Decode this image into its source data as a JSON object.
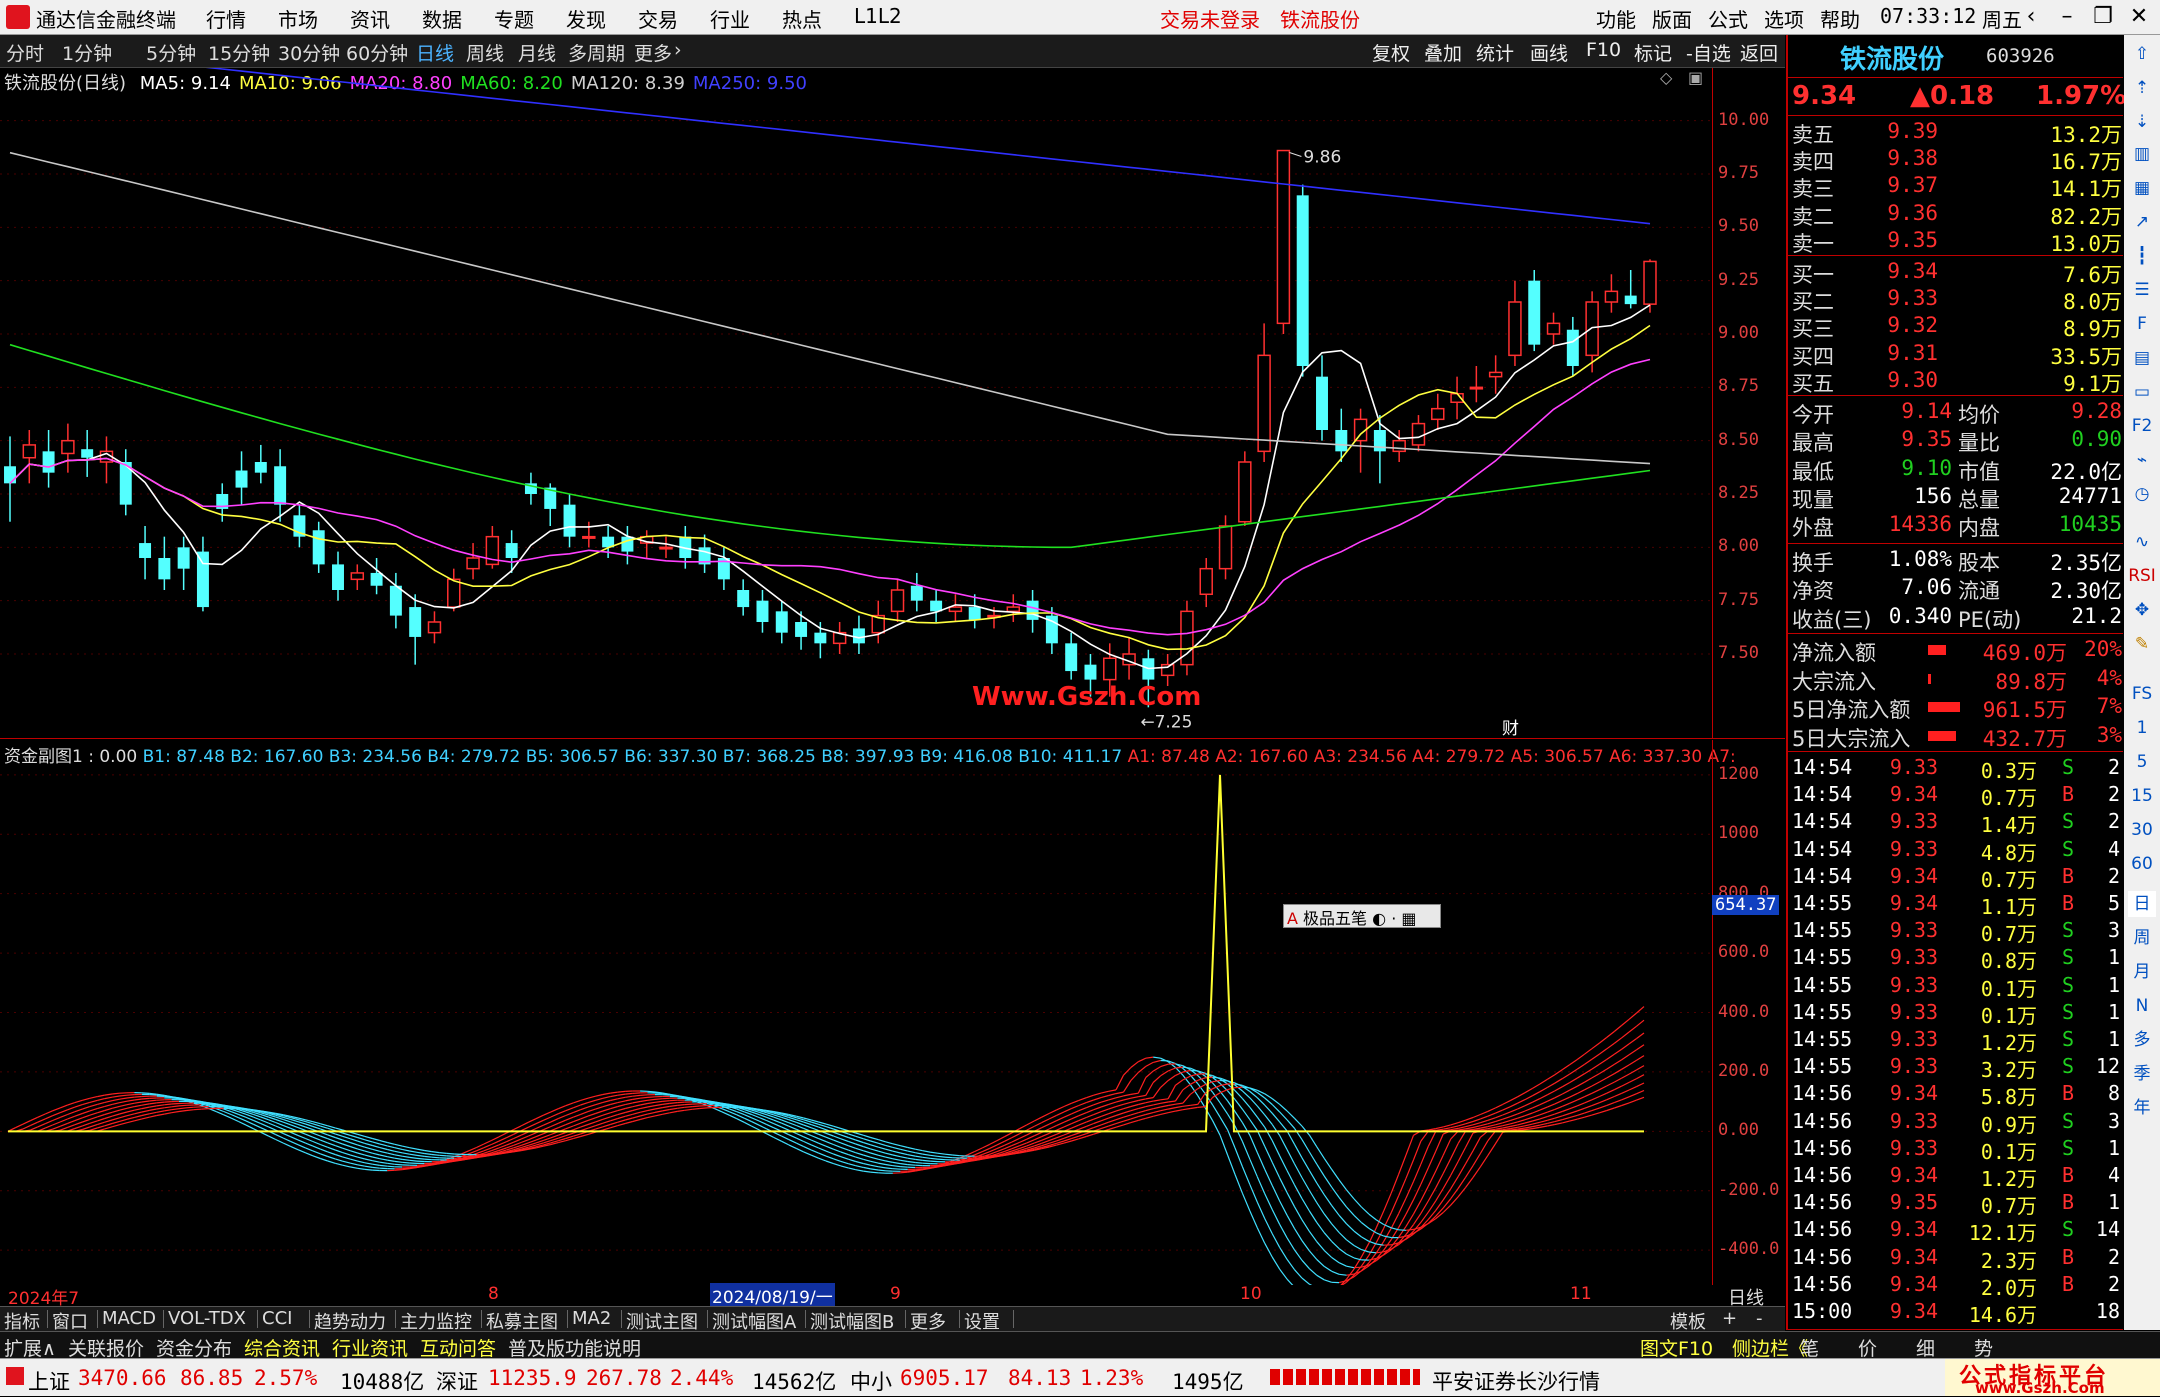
{
  "menubar": {
    "app_title": "通达信金融终端",
    "menus": [
      "行情",
      "市场",
      "资讯",
      "数据",
      "专题",
      "发现",
      "交易",
      "行业",
      "热点",
      "L1L2"
    ],
    "trade_status": "交易未登录",
    "stock_link": "铁流股份",
    "right_menus": [
      "功能",
      "版面",
      "公式",
      "选项",
      "帮助"
    ],
    "clock": "07:33:12",
    "weekday": "周五"
  },
  "periodbar": {
    "periods": [
      "分时",
      "1分钟",
      "5分钟",
      "15分钟",
      "30分钟",
      "60分钟",
      "日线",
      "周线",
      "月线",
      "多周期",
      "更多"
    ],
    "active": "日线",
    "tools": [
      "复权",
      "叠加",
      "统计",
      "画线",
      "F10",
      "标记",
      "-自选",
      "返回"
    ]
  },
  "mainchart": {
    "title": "铁流股份(日线)",
    "ma": [
      {
        "label": "MA5: 9.14",
        "color": "#ffffff"
      },
      {
        "label": "MA10: 9.06",
        "color": "#ffff40"
      },
      {
        "label": "MA20: 8.80",
        "color": "#ff40ff"
      },
      {
        "label": "MA60: 8.20",
        "color": "#20e020"
      },
      {
        "label": "MA120: 8.39",
        "color": "#d0d0d0"
      },
      {
        "label": "MA250: 9.50",
        "color": "#4040ff"
      }
    ],
    "yticks": [
      "10.00",
      "9.75",
      "9.50",
      "9.25",
      "9.00",
      "8.75",
      "8.50",
      "8.25",
      "8.00",
      "7.75",
      "7.50"
    ],
    "high_label": "9.86",
    "low_label": "7.25",
    "watermark": "Www.Gszh.Com",
    "marker": "财"
  },
  "subchart": {
    "title": "资金副图1 : 0.00",
    "b_values": "B1: 87.48  B2: 167.60  B3: 234.56  B4: 279.72  B5: 306.57  B6: 337.30  B7: 368.25  B8: 397.93  B9: 416.08  B10: 411.17",
    "a_values": "A1: 87.48  A2: 167.60  A3: 234.56  A4: 279.72  A5: 306.57  A6: 337.30  A7:",
    "yticks": [
      "1200",
      "1000",
      "800.0",
      "600.0",
      "400.0",
      "200.0",
      "0.00",
      "-200.0",
      "-400.0"
    ],
    "current_value": "654.37",
    "popup_label": "极品五笔",
    "x_labels": [
      "2024年7",
      "8",
      "2024/08/19/一",
      "9",
      "10",
      "11"
    ],
    "period_label": "日线"
  },
  "quote": {
    "name": "铁流股份",
    "code": "603926",
    "price": "9.34",
    "change": "▲0.18",
    "pct": "1.97%",
    "asks": [
      {
        "label": "卖五",
        "price": "9.39",
        "vol": "13.2万"
      },
      {
        "label": "卖四",
        "price": "9.38",
        "vol": "16.7万"
      },
      {
        "label": "卖三",
        "price": "9.37",
        "vol": "14.1万"
      },
      {
        "label": "卖二",
        "price": "9.36",
        "vol": "82.2万"
      },
      {
        "label": "卖一",
        "price": "9.35",
        "vol": "13.0万"
      }
    ],
    "bids": [
      {
        "label": "买一",
        "price": "9.34",
        "vol": "7.6万"
      },
      {
        "label": "买二",
        "price": "9.33",
        "vol": "8.0万"
      },
      {
        "label": "买三",
        "price": "9.32",
        "vol": "8.9万"
      },
      {
        "label": "买四",
        "price": "9.31",
        "vol": "33.5万"
      },
      {
        "label": "买五",
        "price": "9.30",
        "vol": "9.1万"
      }
    ],
    "stats": [
      {
        "l1": "今开",
        "v1": "9.14",
        "c1": "red",
        "l2": "均价",
        "v2": "9.28",
        "c2": "red"
      },
      {
        "l1": "最高",
        "v1": "9.35",
        "c1": "red",
        "l2": "量比",
        "v2": "0.90",
        "c2": "grn"
      },
      {
        "l1": "最低",
        "v1": "9.10",
        "c1": "grn",
        "l2": "市值",
        "v2": "22.0亿",
        "c2": "wht"
      },
      {
        "l1": "现量",
        "v1": "156",
        "c1": "wht",
        "l2": "总量",
        "v2": "24771",
        "c2": "wht"
      },
      {
        "l1": "外盘",
        "v1": "14336",
        "c1": "red",
        "l2": "内盘",
        "v2": "10435",
        "c2": "grn"
      }
    ],
    "fund": [
      {
        "l1": "换手",
        "v1": "1.08%",
        "l2": "股本",
        "v2": "2.35亿"
      },
      {
        "l1": "净资",
        "v1": "7.06",
        "l2": "流通",
        "v2": "2.30亿"
      },
      {
        "l1": "收益(三)",
        "v1": "0.340",
        "l2": "PE(动)",
        "v2": "21.2"
      }
    ],
    "flows": [
      {
        "label": "净流入额",
        "value": "469.0万",
        "pct": "20%",
        "bar": 18
      },
      {
        "label": "大宗流入",
        "value": "89.8万",
        "pct": "4%",
        "bar": 3
      },
      {
        "label": "5日净流入额",
        "value": "961.5万",
        "pct": "7%",
        "bar": 32
      },
      {
        "label": "5日大宗流入",
        "value": "432.7万",
        "pct": "3%",
        "bar": 28
      }
    ],
    "ticks": [
      {
        "t": "14:54",
        "p": "9.33",
        "v": "0.3万",
        "d": "S",
        "n": "2"
      },
      {
        "t": "14:54",
        "p": "9.34",
        "v": "0.7万",
        "d": "B",
        "n": "2"
      },
      {
        "t": "14:54",
        "p": "9.33",
        "v": "1.4万",
        "d": "S",
        "n": "2"
      },
      {
        "t": "14:54",
        "p": "9.33",
        "v": "4.8万",
        "d": "S",
        "n": "4"
      },
      {
        "t": "14:54",
        "p": "9.34",
        "v": "0.7万",
        "d": "B",
        "n": "2"
      },
      {
        "t": "14:55",
        "p": "9.34",
        "v": "1.1万",
        "d": "B",
        "n": "5"
      },
      {
        "t": "14:55",
        "p": "9.33",
        "v": "0.7万",
        "d": "S",
        "n": "3"
      },
      {
        "t": "14:55",
        "p": "9.33",
        "v": "0.8万",
        "d": "S",
        "n": "1"
      },
      {
        "t": "14:55",
        "p": "9.33",
        "v": "0.1万",
        "d": "S",
        "n": "1"
      },
      {
        "t": "14:55",
        "p": "9.33",
        "v": "0.1万",
        "d": "S",
        "n": "1"
      },
      {
        "t": "14:55",
        "p": "9.33",
        "v": "1.2万",
        "d": "S",
        "n": "1"
      },
      {
        "t": "14:55",
        "p": "9.33",
        "v": "3.2万",
        "d": "S",
        "n": "12"
      },
      {
        "t": "14:56",
        "p": "9.34",
        "v": "5.8万",
        "d": "B",
        "n": "8"
      },
      {
        "t": "14:56",
        "p": "9.33",
        "v": "0.9万",
        "d": "S",
        "n": "3"
      },
      {
        "t": "14:56",
        "p": "9.33",
        "v": "0.1万",
        "d": "S",
        "n": "1"
      },
      {
        "t": "14:56",
        "p": "9.34",
        "v": "1.2万",
        "d": "B",
        "n": "4"
      },
      {
        "t": "14:56",
        "p": "9.35",
        "v": "0.7万",
        "d": "B",
        "n": "1"
      },
      {
        "t": "14:56",
        "p": "9.34",
        "v": "12.1万",
        "d": "S",
        "n": "14"
      },
      {
        "t": "14:56",
        "p": "9.34",
        "v": "2.3万",
        "d": "B",
        "n": "2"
      },
      {
        "t": "14:56",
        "p": "9.34",
        "v": "2.0万",
        "d": "B",
        "n": "2"
      },
      {
        "t": "15:00",
        "p": "9.34",
        "v": "14.6万",
        "d": "",
        "n": "18"
      }
    ],
    "bottom_tabs": [
      "笔",
      "价",
      "细",
      "势"
    ]
  },
  "tabs1": [
    "指标",
    "窗口",
    "MACD",
    "VOL-TDX",
    "CCI",
    "趋势动力",
    "主力监控",
    "私募主图",
    "MA2",
    "测试主图",
    "测试幅图A",
    "测试幅图B",
    "更多",
    "设置"
  ],
  "tabs1_right": [
    "模板",
    "+",
    "-"
  ],
  "tabs2": [
    {
      "label": "扩展∧",
      "color": "#ddd"
    },
    {
      "label": "关联报价",
      "color": "#ddd"
    },
    {
      "label": "资金分布",
      "color": "#ddd"
    },
    {
      "label": "综合资讯",
      "color": "#ffff40"
    },
    {
      "label": "行业资讯",
      "color": "#ffff40"
    },
    {
      "label": "互动问答",
      "color": "#ffff40"
    },
    {
      "label": "普及版功能说明",
      "color": "#ddd"
    }
  ],
  "tabs2_right": [
    "图文F10",
    "侧边栏《"
  ],
  "statusbar": {
    "items": [
      {
        "name": "上证",
        "value": "3470.66",
        "chg": "86.85",
        "pct": "2.57%",
        "amt": "10488亿"
      },
      {
        "name": "深证",
        "value": "11235.9",
        "chg": "267.78",
        "pct": "2.44%",
        "amt": "14562亿"
      },
      {
        "name": "中小",
        "value": "6905.17",
        "chg": "84.13",
        "pct": "1.23%",
        "amt": "1495亿"
      }
    ],
    "broker": "平安证券长沙行情",
    "brand": "公式指标平台",
    "brand_url": "www.Gszh.Com"
  },
  "chart_data": [
    {
      "type": "candlestick",
      "title": "铁流股份(日线)",
      "ylim": [
        7.2,
        10.2
      ],
      "candles": [
        [
          8.38,
          8.3,
          8.52,
          8.12
        ],
        [
          8.42,
          8.48,
          8.55,
          8.3
        ],
        [
          8.45,
          8.35,
          8.55,
          8.28
        ],
        [
          8.44,
          8.5,
          8.58,
          8.35
        ],
        [
          8.46,
          8.42,
          8.55,
          8.33
        ],
        [
          8.4,
          8.45,
          8.52,
          8.3
        ],
        [
          8.4,
          8.2,
          8.46,
          8.15
        ],
        [
          8.02,
          7.95,
          8.1,
          7.85
        ],
        [
          7.95,
          7.85,
          8.05,
          7.8
        ],
        [
          8.0,
          7.9,
          8.05,
          7.8
        ],
        [
          7.98,
          7.72,
          8.05,
          7.7
        ],
        [
          8.25,
          8.18,
          8.3,
          8.12
        ],
        [
          8.36,
          8.28,
          8.45,
          8.2
        ],
        [
          8.4,
          8.35,
          8.48,
          8.3
        ],
        [
          8.38,
          8.2,
          8.46,
          8.12
        ],
        [
          8.15,
          8.05,
          8.2,
          8.0
        ],
        [
          8.08,
          7.92,
          8.12,
          7.88
        ],
        [
          7.92,
          7.8,
          7.98,
          7.75
        ],
        [
          7.85,
          7.88,
          7.92,
          7.8
        ],
        [
          7.88,
          7.82,
          7.95,
          7.78
        ],
        [
          7.82,
          7.68,
          7.88,
          7.62
        ],
        [
          7.72,
          7.58,
          7.78,
          7.45
        ],
        [
          7.6,
          7.65,
          7.7,
          7.55
        ],
        [
          7.72,
          7.85,
          7.9,
          7.7
        ],
        [
          7.9,
          7.95,
          8.02,
          7.85
        ],
        [
          7.92,
          8.05,
          8.1,
          7.9
        ],
        [
          8.02,
          7.95,
          8.08,
          7.88
        ],
        [
          8.3,
          8.25,
          8.35,
          8.2
        ],
        [
          8.28,
          8.18,
          8.3,
          8.1
        ],
        [
          8.2,
          8.05,
          8.25,
          8.0
        ],
        [
          8.05,
          8.05,
          8.12,
          8.0
        ],
        [
          8.05,
          8.0,
          8.1,
          7.95
        ],
        [
          8.05,
          7.98,
          8.1,
          7.92
        ],
        [
          8.02,
          8.05,
          8.08,
          7.95
        ],
        [
          8.0,
          8.0,
          8.05,
          7.95
        ],
        [
          8.05,
          7.95,
          8.1,
          7.9
        ],
        [
          8.0,
          7.92,
          8.06,
          7.88
        ],
        [
          7.95,
          7.85,
          8.0,
          7.8
        ],
        [
          7.8,
          7.72,
          7.85,
          7.68
        ],
        [
          7.75,
          7.65,
          7.8,
          7.6
        ],
        [
          7.7,
          7.6,
          7.75,
          7.55
        ],
        [
          7.65,
          7.58,
          7.7,
          7.52
        ],
        [
          7.6,
          7.55,
          7.65,
          7.48
        ],
        [
          7.55,
          7.6,
          7.65,
          7.5
        ],
        [
          7.62,
          7.55,
          7.68,
          7.5
        ],
        [
          7.6,
          7.68,
          7.75,
          7.55
        ],
        [
          7.7,
          7.8,
          7.85,
          7.65
        ],
        [
          7.82,
          7.75,
          7.88,
          7.7
        ],
        [
          7.75,
          7.7,
          7.8,
          7.65
        ],
        [
          7.7,
          7.72,
          7.78,
          7.65
        ],
        [
          7.72,
          7.66,
          7.78,
          7.62
        ],
        [
          7.68,
          7.68,
          7.72,
          7.62
        ],
        [
          7.7,
          7.72,
          7.78,
          7.65
        ],
        [
          7.75,
          7.66,
          7.8,
          7.6
        ],
        [
          7.68,
          7.55,
          7.72,
          7.5
        ],
        [
          7.55,
          7.42,
          7.6,
          7.38
        ],
        [
          7.45,
          7.38,
          7.5,
          7.3
        ],
        [
          7.38,
          7.48,
          7.55,
          7.3
        ],
        [
          7.45,
          7.5,
          7.58,
          7.38
        ],
        [
          7.48,
          7.38,
          7.52,
          7.25
        ],
        [
          7.4,
          7.45,
          7.5,
          7.35
        ],
        [
          7.45,
          7.7,
          7.75,
          7.4
        ],
        [
          7.78,
          7.9,
          7.95,
          7.72
        ],
        [
          7.9,
          8.1,
          8.15,
          7.85
        ],
        [
          8.12,
          8.4,
          8.45,
          8.1
        ],
        [
          8.45,
          8.9,
          9.05,
          8.4
        ],
        [
          9.05,
          9.86,
          9.86,
          9.0
        ],
        [
          9.65,
          8.85,
          9.7,
          8.8
        ],
        [
          8.8,
          8.55,
          8.9,
          8.5
        ],
        [
          8.55,
          8.45,
          8.65,
          8.4
        ],
        [
          8.5,
          8.6,
          8.65,
          8.35
        ],
        [
          8.55,
          8.45,
          8.62,
          8.3
        ],
        [
          8.45,
          8.5,
          8.55,
          8.4
        ],
        [
          8.48,
          8.58,
          8.62,
          8.45
        ],
        [
          8.6,
          8.65,
          8.72,
          8.55
        ],
        [
          8.68,
          8.72,
          8.8,
          8.6
        ],
        [
          8.75,
          8.75,
          8.85,
          8.68
        ],
        [
          8.8,
          8.82,
          8.9,
          8.72
        ],
        [
          8.9,
          9.15,
          9.25,
          8.85
        ],
        [
          9.25,
          8.95,
          9.3,
          8.92
        ],
        [
          9.0,
          9.05,
          9.1,
          8.95
        ],
        [
          9.02,
          8.85,
          9.08,
          8.8
        ],
        [
          8.9,
          9.15,
          9.2,
          8.82
        ],
        [
          9.15,
          9.2,
          9.28,
          9.1
        ],
        [
          9.18,
          9.14,
          9.3,
          9.12
        ],
        [
          9.14,
          9.34,
          9.35,
          9.1
        ]
      ]
    },
    {
      "type": "line",
      "title": "资金副图1",
      "ylim": [
        -450,
        1250
      ],
      "series_names": [
        "B1",
        "B2",
        "B3",
        "B4",
        "B5",
        "B6",
        "B7",
        "B8",
        "B9",
        "B10"
      ],
      "last_values": [
        87.48,
        167.6,
        234.56,
        279.72,
        306.57,
        337.3,
        368.25,
        397.93,
        416.08,
        411.17
      ],
      "spike": 1200
    }
  ]
}
